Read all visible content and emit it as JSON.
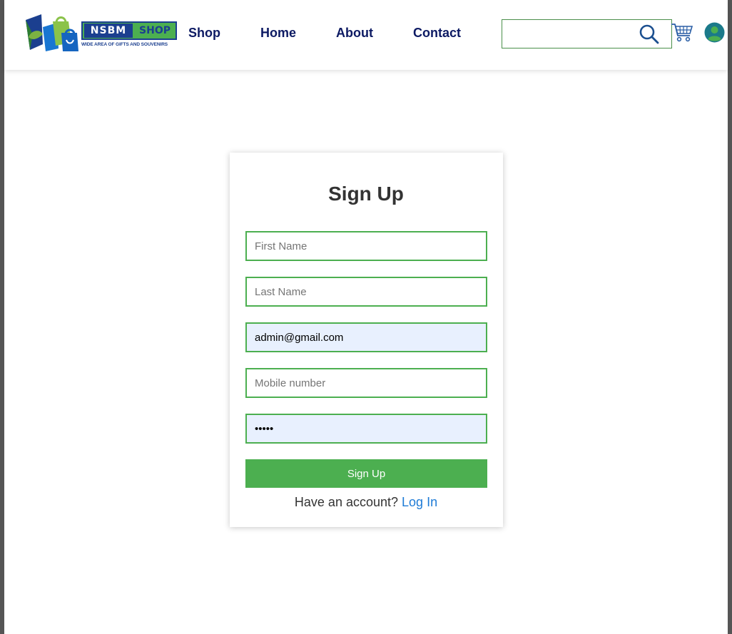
{
  "header": {
    "logo": {
      "brand": "NSBM",
      "shop": "SHOP",
      "tagline": "WIDE AREA OF GIFTS AND SOUVENIRS"
    },
    "nav": [
      {
        "label": "Shop"
      },
      {
        "label": "Home"
      },
      {
        "label": "About"
      },
      {
        "label": "Contact"
      }
    ],
    "search": {
      "placeholder": "",
      "value": ""
    },
    "icons": {
      "search": "search-icon",
      "cart": "cart-icon",
      "profile": "profile-icon"
    }
  },
  "form": {
    "title": "Sign Up",
    "fields": {
      "first_name": {
        "placeholder": "First Name",
        "value": ""
      },
      "last_name": {
        "placeholder": "Last Name",
        "value": ""
      },
      "email": {
        "placeholder": "",
        "value": "admin@gmail.com"
      },
      "mobile": {
        "placeholder": "Mobile number",
        "value": ""
      },
      "password": {
        "placeholder": "",
        "value": "12345"
      }
    },
    "submit_label": "Sign Up",
    "account_prompt": "Have an account?",
    "login_label": "Log In"
  },
  "colors": {
    "accent_green": "#4caf50",
    "nav_text": "#0d1a63",
    "brand_blue": "#1b3f8f",
    "link_blue": "#1e7bd6",
    "autofill_bg": "#e8f0fe"
  }
}
